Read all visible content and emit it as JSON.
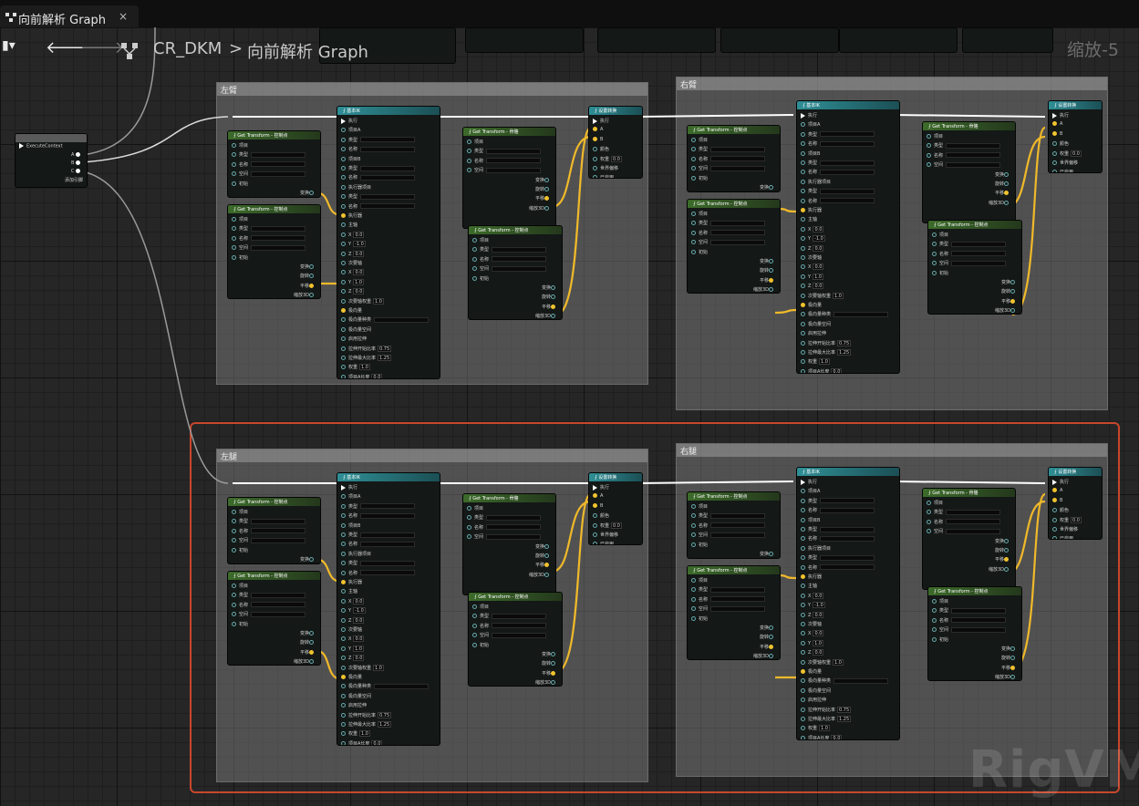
{
  "tab": {
    "title": "向前解析 Graph",
    "close": "×"
  },
  "breadcrumb": {
    "root": "CR_DKM",
    "sep": ">",
    "current": "向前解析 Graph"
  },
  "zoom": "缩放-5",
  "watermark": "RigVM",
  "entry_node": {
    "event": "ExecuteContext",
    "pins": [
      "A",
      "B",
      "C"
    ],
    "add_pin": "添加引脚"
  },
  "comments": [
    "左臂",
    "右臂",
    "左腿",
    "右腿"
  ],
  "node_titles": {
    "get_transform": "Get Transform - 控制点",
    "get_transform_bone": "Get Transform - 骨骼",
    "basic_ik": "基本IK",
    "set_transform": "设置转换"
  },
  "labels": {
    "exec": "执行",
    "item": "项目",
    "type": "类型",
    "name": "名称",
    "space": "空间",
    "initial": "初始",
    "transform": "变换",
    "rotation": "旋转",
    "translation": "平移",
    "scale3d": "缩放3D",
    "item_a": "项目A",
    "item_b": "项目B",
    "effector_item": "执行器项目",
    "effector": "执行器",
    "primary_axis": "主轴",
    "secondary_axis": "次要轴",
    "secondary_weight": "次要轴权重",
    "pole_vector": "极向量",
    "pole_kind": "极向量种类",
    "pole_space": "极向量空间",
    "enable_stretch": "启用拉伸",
    "stretch_start": "拉伸开始比率",
    "stretch_max": "拉伸最大比率",
    "weight": "权重",
    "len_a": "项目A长度",
    "len_b": "项目B长度",
    "propagate": "传播到子项",
    "weight_set": "权重",
    "world_offset": "世界偏移",
    "enabled": "已启用",
    "color": "颜色"
  },
  "values": {
    "x": "X",
    "y": "Y",
    "z": "Z",
    "v0": "0.0",
    "v1": "1.0",
    "vneg1": "-1.0",
    "v075": "0.75",
    "v125": "1.25"
  }
}
